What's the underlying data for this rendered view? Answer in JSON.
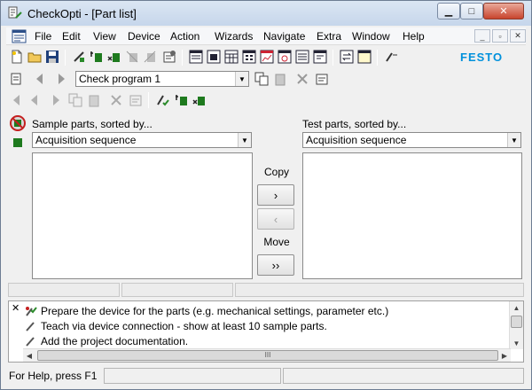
{
  "window": {
    "title": "CheckOpti - [Part list]",
    "min_label": "▁",
    "max_label": "□",
    "close_label": "✕"
  },
  "menu": {
    "items": [
      "File",
      "Edit",
      "View",
      "Device",
      "Action",
      "Wizards",
      "Navigate",
      "Extra",
      "Window",
      "Help"
    ],
    "mdi_min": "_",
    "mdi_restore": "▫",
    "mdi_close": "✕"
  },
  "toolbar": {
    "brand": "FESTO",
    "brand_color": "#0091dc"
  },
  "program_selector": {
    "value": "Check program 1"
  },
  "sample_panel": {
    "label": "Sample parts, sorted by...",
    "sort_value": "Acquisition sequence"
  },
  "test_panel": {
    "label": "Test parts, sorted by...",
    "sort_value": "Acquisition sequence"
  },
  "transfer": {
    "copy_label": "Copy",
    "copy_right": "›",
    "copy_left": "‹",
    "move_label": "Move",
    "move_right": "››"
  },
  "output": {
    "close": "✕",
    "lines": [
      "Prepare the device for the parts (e.g. mechanical settings, parameter etc.)",
      "Teach via device connection - show at least 10 sample parts.",
      "Add the project documentation."
    ],
    "scroll_thumb": "III"
  },
  "statusbar": {
    "text": "For Help, press F1"
  }
}
